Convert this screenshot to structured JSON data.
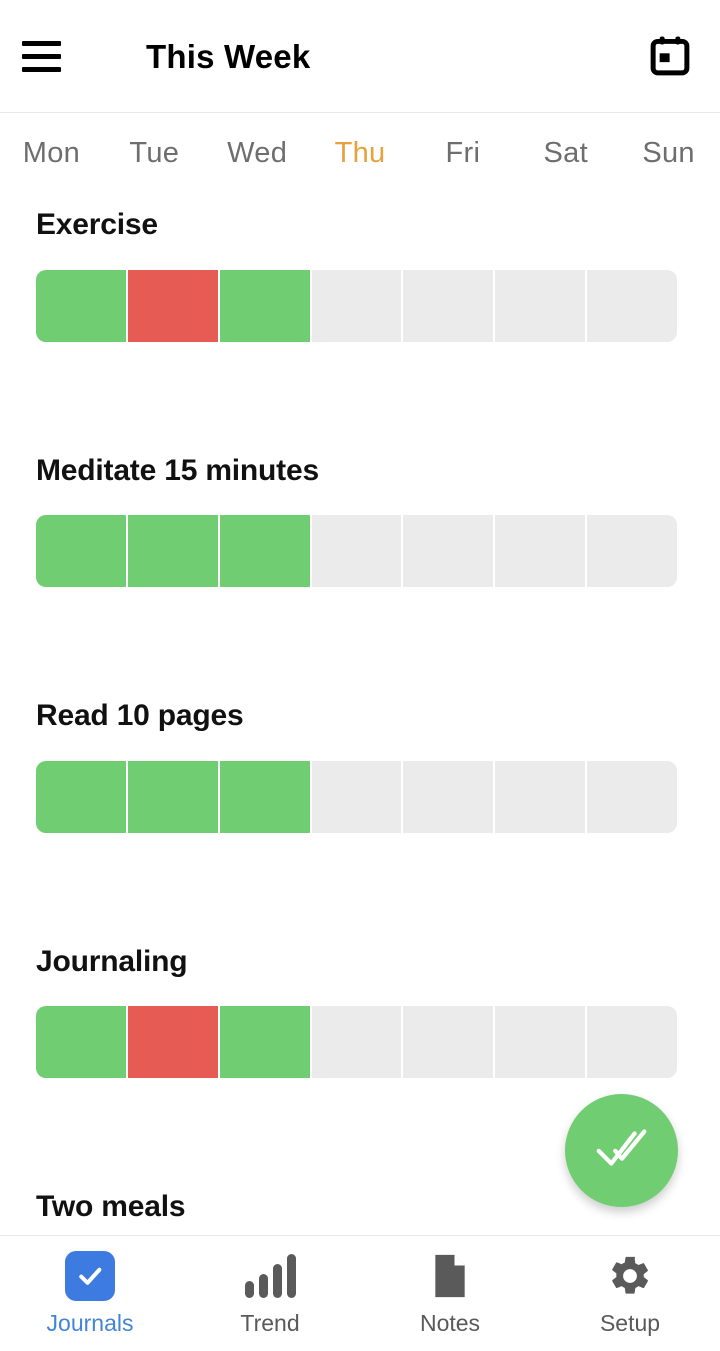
{
  "appbar": {
    "menu_icon": "hamburger-menu-icon",
    "title": "This Week",
    "calendar_icon": "calendar-icon"
  },
  "weekdays": {
    "today": "Thu",
    "today_color": "#e6a23c",
    "items": [
      {
        "label": "Mon"
      },
      {
        "label": "Tue"
      },
      {
        "label": "Wed"
      },
      {
        "label": "Thu"
      },
      {
        "label": "Fri"
      },
      {
        "label": "Sat"
      },
      {
        "label": "Sun"
      }
    ]
  },
  "colors": {
    "done": "#71cd72",
    "missed": "#e75b55",
    "empty": "#ebebeb",
    "accent_blue": "#3d7be0",
    "today_orange": "#e6a23c"
  },
  "habits": [
    {
      "name": "Exercise",
      "days": [
        "done",
        "missed",
        "done",
        "empty",
        "empty",
        "empty",
        "empty"
      ]
    },
    {
      "name": "Meditate 15 minutes",
      "days": [
        "done",
        "done",
        "done",
        "empty",
        "empty",
        "empty",
        "empty"
      ]
    },
    {
      "name": "Read 10 pages",
      "days": [
        "done",
        "done",
        "done",
        "empty",
        "empty",
        "empty",
        "empty"
      ]
    },
    {
      "name": "Journaling",
      "days": [
        "done",
        "missed",
        "done",
        "empty",
        "empty",
        "empty",
        "empty"
      ]
    },
    {
      "name": "Two meals",
      "days": [
        "done",
        "done",
        "done",
        "empty",
        "empty",
        "empty",
        "empty"
      ]
    }
  ],
  "fab": {
    "icon": "double-check-icon",
    "color": "#71cd72"
  },
  "bottomnav": {
    "active_index": 0,
    "items": [
      {
        "label": "Journals",
        "icon": "checkbox-check-icon"
      },
      {
        "label": "Trend",
        "icon": "bar-chart-icon"
      },
      {
        "label": "Notes",
        "icon": "document-icon"
      },
      {
        "label": "Setup",
        "icon": "gear-icon"
      }
    ]
  }
}
